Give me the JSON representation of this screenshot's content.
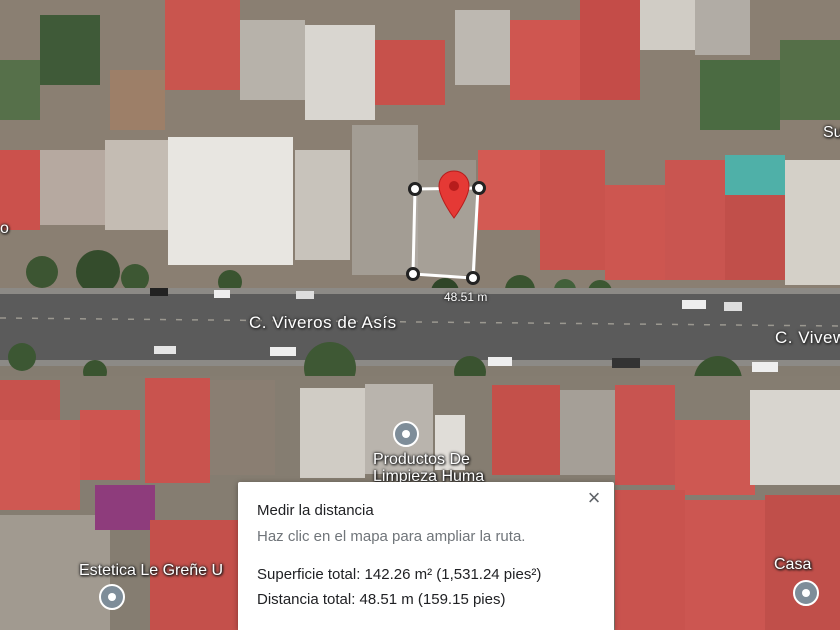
{
  "map": {
    "streets": [
      {
        "id": "main-left",
        "label": "C. Viveros de Asís"
      },
      {
        "id": "main-right",
        "label": "C. Vivew"
      }
    ],
    "pois": [
      {
        "id": "productos",
        "lines": [
          "Productos De",
          "Limpieza Huma"
        ]
      },
      {
        "id": "estetica",
        "label": "Estetica Le Greñe U"
      },
      {
        "id": "casa",
        "label": "Casa"
      }
    ],
    "edge_labels": {
      "top_right": "Su",
      "left_mid": "o"
    },
    "measurement": {
      "segment_label": "48.51 m"
    }
  },
  "panel": {
    "title": "Medir la distancia",
    "hint": "Haz clic en el mapa para ampliar la ruta.",
    "area_text": "Superficie total: 142.26 m² (1,531.24 pies²)",
    "distance_text": "Distancia total: 48.51 m (159.15 pies)",
    "close_label": "×"
  },
  "colors": {
    "roof_red": "#c4524c",
    "road": "#5c5c5c",
    "pin_red": "#e53935",
    "poi_pin": "#7e8d99"
  }
}
